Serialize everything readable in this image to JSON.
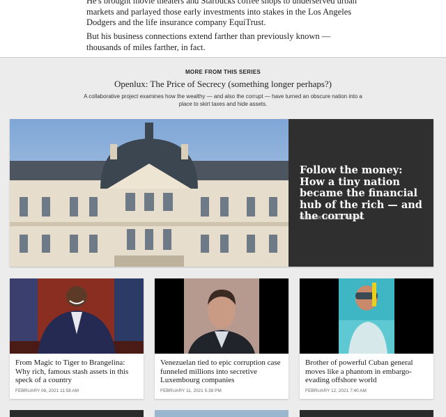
{
  "article": {
    "paragraph1": "He's brought movie theaters and Starbucks coffee shops to underserved urban markets and parlayed those early investments into stakes in the Los Angeles Dodgers and the life insurance company EquiTrust.",
    "paragraph2": "But his business connections extend farther than previously known — thousands of miles farther, in fact."
  },
  "series": {
    "kicker": "MORE FROM THIS SERIES",
    "title": "Openlux: The Price of Secrecy (something longer perhaps?)",
    "description": "A collaborative project examines how the wealthy — and also the corrupt — have turned an obscure nation into a place to skirt taxes and hide assets."
  },
  "hero": {
    "headline": "Follow the money: How a tiny nation became the financial hub of the rich — and the corrupt",
    "date": "FEBRUARY 09, 2021 7:00 AM"
  },
  "cards": [
    {
      "headline": "From Magic to Tiger to Brangelina: Why rich, famous stash assets in this speck of a country",
      "date": "FEBRUARY 08, 2021 11:58 AM"
    },
    {
      "headline": "Venezuelan tied to epic corruption case funneled millions into secretive Luxembourg companies",
      "date": "FEBRUARY 11, 2021 5:38 PM"
    },
    {
      "headline": "Brother of powerful Cuban general moves like a phantom in embargo-evading offshore world",
      "date": "FEBRUARY 12, 2021 7:40 AM"
    }
  ]
}
